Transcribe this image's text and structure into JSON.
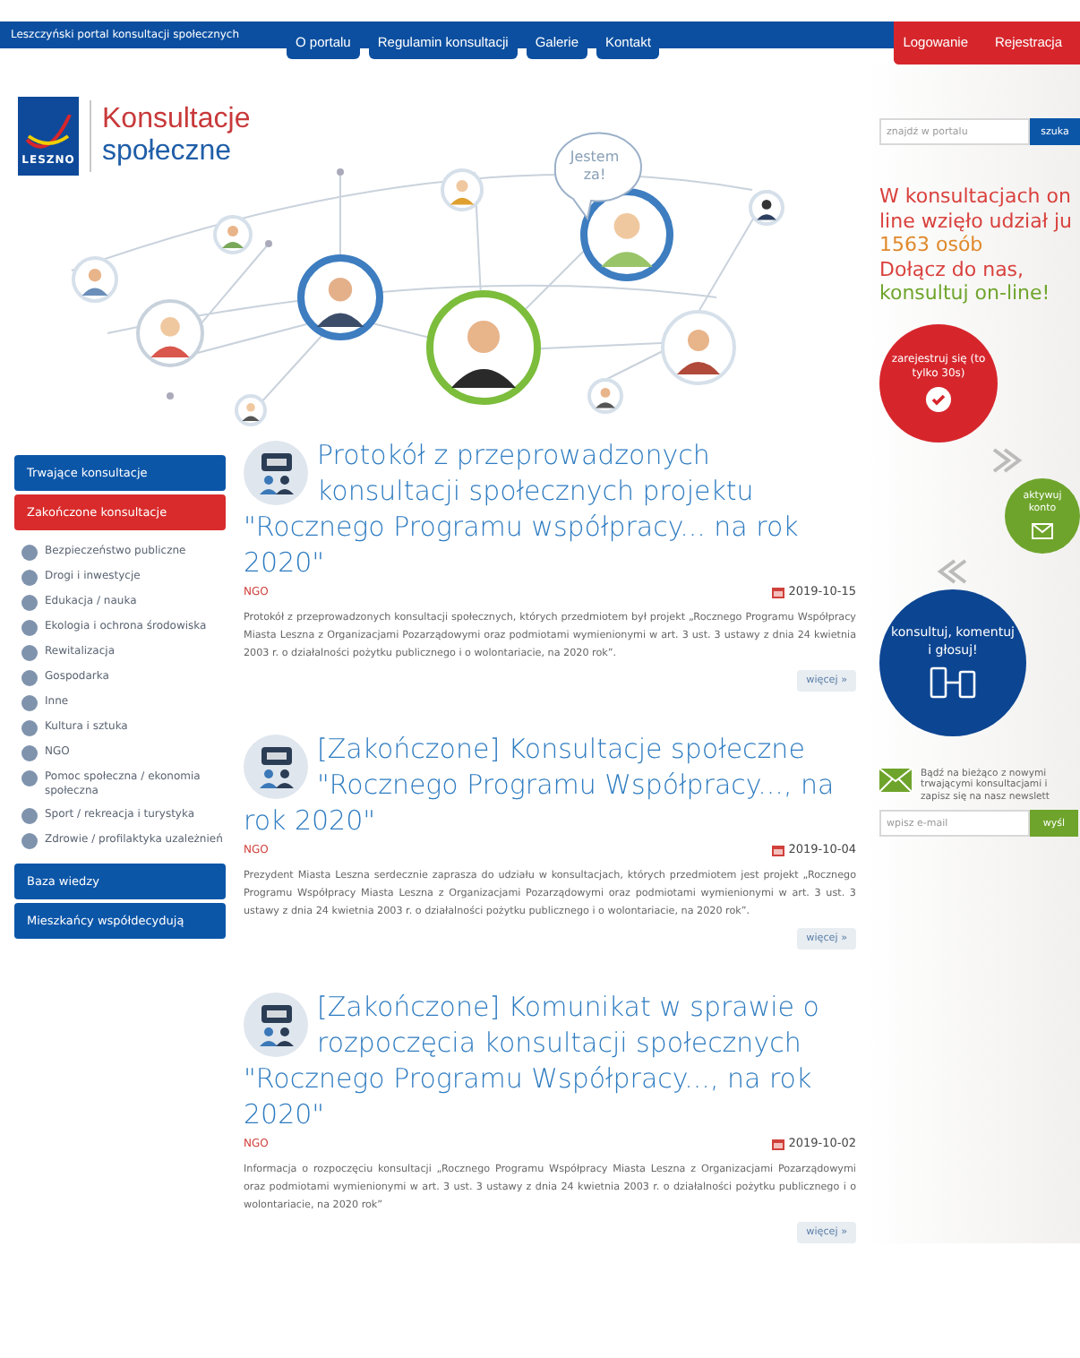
{
  "header": {
    "site_name": "Leszczyński portal konsultacji społecznych",
    "nav": [
      "O portalu",
      "Regulamin konsultacji",
      "Galerie",
      "Kontakt"
    ],
    "account": [
      "Logowanie",
      "Rejestracja"
    ]
  },
  "logo": {
    "badge": "LESZNO",
    "title": "Konsultacje",
    "subtitle": "społeczne"
  },
  "illustration": {
    "bubble": [
      "Jestem",
      "za!"
    ]
  },
  "search": {
    "placeholder": "znajdź w portalu",
    "button": "szuka"
  },
  "promo": [
    {
      "text": "W konsultacjach on",
      "color": "#d9413d"
    },
    {
      "text": "line wzięło udział ju",
      "color": "#d9413d"
    },
    {
      "text": "1563 osób",
      "color": "#e0892c"
    },
    {
      "text": "Dołącz do nas,",
      "color": "#d9413d"
    },
    {
      "text": "konsultuj on-line!",
      "color": "#6fa52c"
    }
  ],
  "sidebar": [
    {
      "label": "Trwające konsultacje",
      "selected": false
    },
    {
      "label": "Zakończone konsultacje",
      "selected": true,
      "categories": [
        "Bezpieczeństwo publiczne",
        "Drogi i inwestycje",
        "Edukacja / nauka",
        "Ekologia i ochrona środowiska",
        "Rewitalizacja",
        "Gospodarka",
        "Inne",
        "Kultura i sztuka",
        "NGO",
        "Pomoc społeczna / ekonomia społeczna",
        "Sport / rekreacja i turystyka",
        "Zdrowie / profilaktyka uzależnień"
      ]
    },
    {
      "label": "Baza wiedzy",
      "selected": false
    },
    {
      "label": "Mieszkańcy współdecydują",
      "selected": false
    }
  ],
  "articles": [
    {
      "title": "Protokół z przeprowadzonych konsultacji społecznych projektu \"Rocznego Programu współpracy... na rok 2020\"",
      "category": "NGO",
      "date": "2019-10-15",
      "body": "Protokół z przeprowadzonych konsultacji społecznych, których przedmiotem był projekt „Rocznego Programu Współpracy Miasta Leszna z Organizacjami Pozarządowymi oraz podmiotami wymienionymi w art. 3 ust. 3 ustawy z dnia 24 kwietnia 2003 r. o działalności pożytku publicznego i o wolontariacie, na 2020 rok”.",
      "more": "więcej »"
    },
    {
      "title": "[Zakończone] Konsultacje społeczne \"Rocznego Programu Współpracy..., na rok 2020\"",
      "category": "NGO",
      "date": "2019-10-04",
      "body": "Prezydent Miasta Leszna serdecznie zaprasza do udziału w konsultacjach, których przedmiotem jest projekt „Rocznego Programu Współpracy Miasta Leszna z Organizacjami Pozarządowymi oraz podmiotami wymienionymi w art. 3 ust. 3 ustawy z dnia 24 kwietnia 2003 r. o działalności pożytku publicznego i o wolontariacie, na 2020 rok”.",
      "more": "więcej »"
    },
    {
      "title": "[Zakończone] Komunikat w sprawie o rozpoczęcia konsultacji społecznych \"Rocznego Programu Współpracy..., na rok 2020\"",
      "category": "NGO",
      "date": "2019-10-02",
      "body": "Informacja o rozpoczęciu konsultacji „Rocznego Programu Współpracy Miasta Leszna z Organizacjami Pozarządowymi oraz podmiotami wymienionymi w art. 3 ust. 3 ustawy z dnia 24 kwietnia 2003 r. o działalności pożytku publicznego i o wolontariacie, na 2020 rok”",
      "more": "więcej »"
    }
  ],
  "steps": [
    {
      "kind": "register",
      "text": "zarejestruj się (to tylko 30s)"
    },
    {
      "kind": "activate",
      "text": "aktywuj konto"
    },
    {
      "kind": "consult",
      "text": "konsultuj, komentuj i głosuj!"
    }
  ],
  "newsletter": {
    "lines": [
      "Bądź na bieżąco z nowymi",
      "trwającymi konsultacjami i",
      "zapisz się na nasz newslett"
    ],
    "placeholder": "wpisz e-mail",
    "button": "wyśl"
  }
}
